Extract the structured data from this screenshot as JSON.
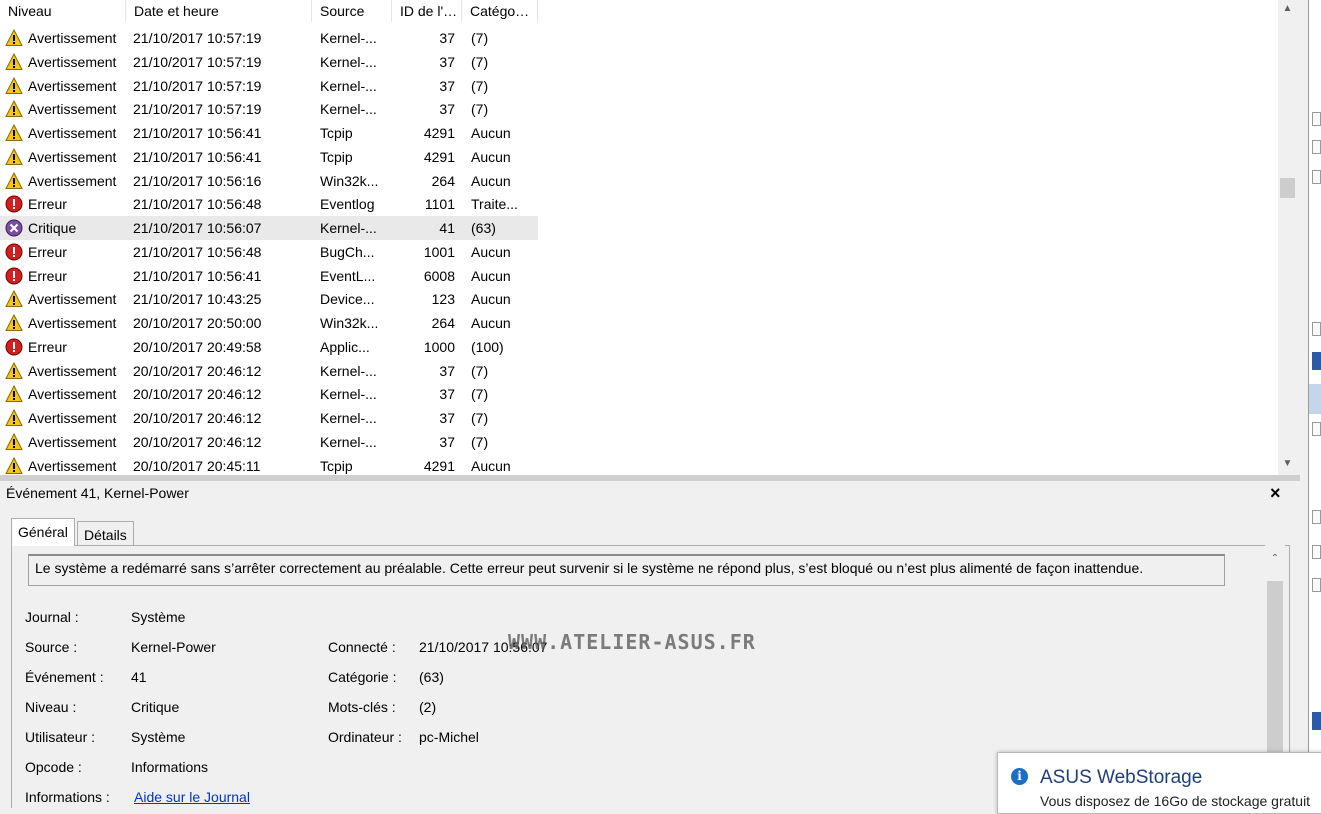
{
  "list": {
    "columns": [
      "Niveau",
      "Date et heure",
      "Source",
      "ID de l'…",
      "Catégo…"
    ],
    "rows": [
      {
        "level": "Avertissement",
        "icon": "warning-icon",
        "date": "21/10/2017 10:57:19",
        "source": "Kernel-...",
        "id": "37",
        "category": "(7)"
      },
      {
        "level": "Avertissement",
        "icon": "warning-icon",
        "date": "21/10/2017 10:57:19",
        "source": "Kernel-...",
        "id": "37",
        "category": "(7)"
      },
      {
        "level": "Avertissement",
        "icon": "warning-icon",
        "date": "21/10/2017 10:57:19",
        "source": "Kernel-...",
        "id": "37",
        "category": "(7)"
      },
      {
        "level": "Avertissement",
        "icon": "warning-icon",
        "date": "21/10/2017 10:57:19",
        "source": "Kernel-...",
        "id": "37",
        "category": "(7)"
      },
      {
        "level": "Avertissement",
        "icon": "warning-icon",
        "date": "21/10/2017 10:56:41",
        "source": "Tcpip",
        "id": "4291",
        "category": "Aucun"
      },
      {
        "level": "Avertissement",
        "icon": "warning-icon",
        "date": "21/10/2017 10:56:41",
        "source": "Tcpip",
        "id": "4291",
        "category": "Aucun"
      },
      {
        "level": "Avertissement",
        "icon": "warning-icon",
        "date": "21/10/2017 10:56:16",
        "source": "Win32k...",
        "id": "264",
        "category": "Aucun"
      },
      {
        "level": "Erreur",
        "icon": "error-icon",
        "date": "21/10/2017 10:56:48",
        "source": "Eventlog",
        "id": "1101",
        "category": "Traite..."
      },
      {
        "level": "Critique",
        "icon": "critical-icon",
        "date": "21/10/2017 10:56:07",
        "source": "Kernel-...",
        "id": "41",
        "category": "(63)",
        "selected": true
      },
      {
        "level": "Erreur",
        "icon": "error-icon",
        "date": "21/10/2017 10:56:48",
        "source": "BugCh...",
        "id": "1001",
        "category": "Aucun"
      },
      {
        "level": "Erreur",
        "icon": "error-icon",
        "date": "21/10/2017 10:56:41",
        "source": "EventL...",
        "id": "6008",
        "category": "Aucun"
      },
      {
        "level": "Avertissement",
        "icon": "warning-icon",
        "date": "21/10/2017 10:43:25",
        "source": "Device...",
        "id": "123",
        "category": "Aucun"
      },
      {
        "level": "Avertissement",
        "icon": "warning-icon",
        "date": "20/10/2017 20:50:00",
        "source": "Win32k...",
        "id": "264",
        "category": "Aucun"
      },
      {
        "level": "Erreur",
        "icon": "error-icon",
        "date": "20/10/2017 20:49:58",
        "source": "Applic...",
        "id": "1000",
        "category": "(100)"
      },
      {
        "level": "Avertissement",
        "icon": "warning-icon",
        "date": "20/10/2017 20:46:12",
        "source": "Kernel-...",
        "id": "37",
        "category": "(7)"
      },
      {
        "level": "Avertissement",
        "icon": "warning-icon",
        "date": "20/10/2017 20:46:12",
        "source": "Kernel-...",
        "id": "37",
        "category": "(7)"
      },
      {
        "level": "Avertissement",
        "icon": "warning-icon",
        "date": "20/10/2017 20:46:12",
        "source": "Kernel-...",
        "id": "37",
        "category": "(7)"
      },
      {
        "level": "Avertissement",
        "icon": "warning-icon",
        "date": "20/10/2017 20:46:12",
        "source": "Kernel-...",
        "id": "37",
        "category": "(7)"
      },
      {
        "level": "Avertissement",
        "icon": "warning-icon",
        "date": "20/10/2017 20:45:11",
        "source": "Tcpip",
        "id": "4291",
        "category": "Aucun"
      }
    ]
  },
  "detail": {
    "title": "Événement 41, Kernel-Power",
    "close": "×",
    "tabs": {
      "general": "Général",
      "details": "Détails"
    },
    "description": "Le système a redémarré sans s’arrêter correctement au préalable. Cette erreur peut survenir si le système ne répond plus, s’est bloqué ou n’est plus alimenté de façon inattendue.",
    "labels": {
      "journal": "Journal :",
      "source": "Source :",
      "event": "Événement :",
      "level": "Niveau :",
      "user": "Utilisateur :",
      "opcode": "Opcode :",
      "info": "Informations :",
      "logged": "Connecté :",
      "category": "Catégorie :",
      "keywords": "Mots-clés :",
      "computer": "Ordinateur :"
    },
    "values": {
      "journal": "Système",
      "source": "Kernel-Power",
      "event": "41",
      "level": "Critique",
      "user": "Système",
      "opcode": "Informations",
      "info_link": "Aide sur le Journal",
      "logged": "21/10/2017 10:56:07",
      "category": "(63)",
      "keywords": "(2)",
      "computer": "pc-Michel"
    }
  },
  "watermark": "WWW.ATELIER-ASUS.FR",
  "toast": {
    "title": "ASUS WebStorage",
    "text": "Vous disposez de 16Go de stockage gratuit",
    "icon": "info-icon"
  },
  "colors": {
    "warning": "#f5c518",
    "error": "#d02020",
    "critical": "#7a4fa0",
    "link": "#0033cc",
    "selected_row": "#e9e9e9"
  }
}
